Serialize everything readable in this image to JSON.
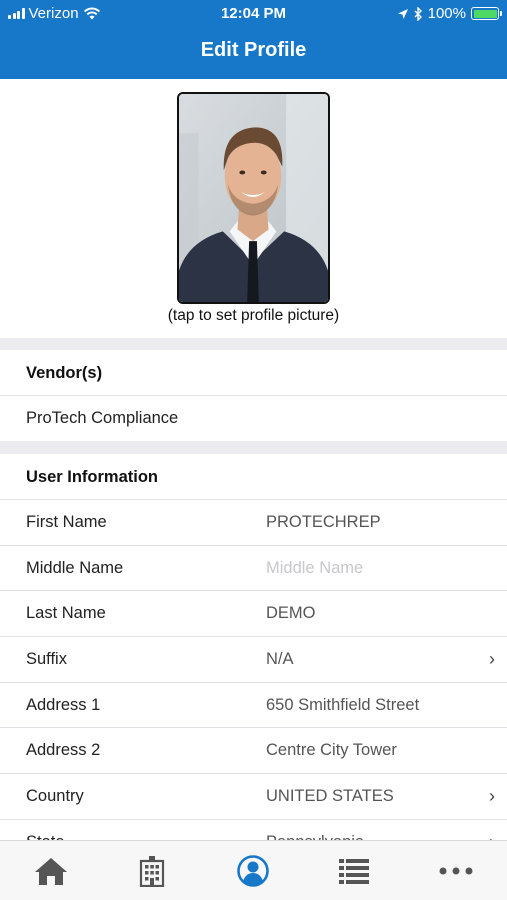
{
  "status_bar": {
    "carrier": "Verizon",
    "time": "12:04 PM",
    "battery": "100%",
    "battery_level": 1.0,
    "icons": [
      "signal-icon",
      "wifi-icon",
      "location-icon",
      "bluetooth-icon",
      "battery-icon"
    ]
  },
  "nav": {
    "title": "Edit Profile"
  },
  "profile_photo": {
    "caption": "(tap to set profile picture)"
  },
  "vendors": {
    "heading": "Vendor(s)",
    "items": [
      "ProTech Compliance"
    ]
  },
  "user_info": {
    "heading": "User Information",
    "fields": [
      {
        "label": "First Name",
        "value": "PROTECHREP"
      },
      {
        "label": "Middle Name",
        "placeholder": "Middle Name"
      },
      {
        "label": "Last Name",
        "value": "DEMO"
      },
      {
        "label": "Suffix",
        "value": "N/A"
      },
      {
        "label": "Address 1",
        "value": "650 Smithfield Street"
      },
      {
        "label": "Address 2",
        "value": "Centre City Tower"
      },
      {
        "label": "Country",
        "value": "UNITED STATES"
      },
      {
        "label": "State",
        "value": "Pennsylvania"
      }
    ]
  },
  "tab_bar": {
    "tabs": [
      {
        "icon": "home-icon"
      },
      {
        "icon": "building-icon"
      },
      {
        "icon": "profile-icon",
        "active": true
      },
      {
        "icon": "list-icon"
      },
      {
        "icon": "more-icon"
      }
    ]
  },
  "colors": {
    "accent": "#1778c9",
    "battery": "#4cd964",
    "tab_inactive": "#555555",
    "section_gap": "#ececf0"
  }
}
